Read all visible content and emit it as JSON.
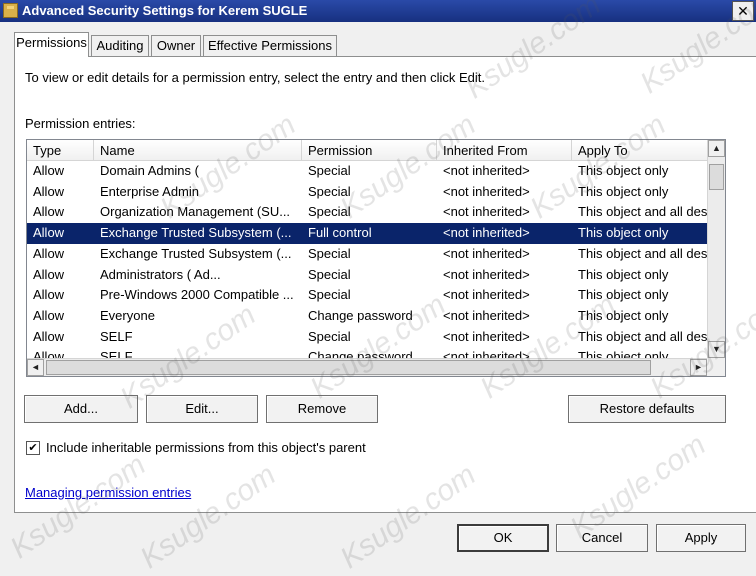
{
  "window": {
    "title": "Advanced Security Settings for Kerem SUGLE",
    "close_glyph": "✕"
  },
  "tabs": [
    {
      "label": "Permissions",
      "active": true
    },
    {
      "label": "Auditing",
      "active": false
    },
    {
      "label": "Owner",
      "active": false
    },
    {
      "label": "Effective Permissions",
      "active": false
    }
  ],
  "instruction": "To view or edit details for a permission entry, select the entry and then click Edit.",
  "entries_label": "Permission entries:",
  "columns": [
    "Type",
    "Name",
    "Permission",
    "Inherited From",
    "Apply To"
  ],
  "rows": [
    {
      "type": "Allow",
      "name": "Domain Admins (",
      "permission": "Special",
      "inherited": "<not inherited>",
      "apply": "This object only",
      "selected": false
    },
    {
      "type": "Allow",
      "name": "Enterprise Admin",
      "permission": "Special",
      "inherited": "<not inherited>",
      "apply": "This object only",
      "selected": false
    },
    {
      "type": "Allow",
      "name": "Organization Management (SU...",
      "permission": "Special",
      "inherited": "<not inherited>",
      "apply": "This object and all des",
      "selected": false
    },
    {
      "type": "Allow",
      "name": "Exchange Trusted Subsystem (...",
      "permission": "Full control",
      "inherited": "<not inherited>",
      "apply": "This object only",
      "selected": true
    },
    {
      "type": "Allow",
      "name": "Exchange Trusted Subsystem (...",
      "permission": "Special",
      "inherited": "<not inherited>",
      "apply": "This object and all des",
      "selected": false
    },
    {
      "type": "Allow",
      "name": "Administrators (                    Ad...",
      "permission": "Special",
      "inherited": "<not inherited>",
      "apply": "This object only",
      "selected": false
    },
    {
      "type": "Allow",
      "name": "Pre-Windows 2000 Compatible ...",
      "permission": "Special",
      "inherited": "<not inherited>",
      "apply": "This object only",
      "selected": false
    },
    {
      "type": "Allow",
      "name": "Everyone",
      "permission": "Change password",
      "inherited": "<not inherited>",
      "apply": "This object only",
      "selected": false
    },
    {
      "type": "Allow",
      "name": "SELF",
      "permission": "Special",
      "inherited": "<not inherited>",
      "apply": "This object and all des",
      "selected": false
    },
    {
      "type": "Allow",
      "name": "SELF",
      "permission": "Change password",
      "inherited": "<not inherited>",
      "apply": "This object only",
      "selected": false
    }
  ],
  "buttons": {
    "add": "Add...",
    "edit": "Edit...",
    "remove": "Remove",
    "restore": "Restore defaults",
    "ok": "OK",
    "cancel": "Cancel",
    "apply": "Apply"
  },
  "inherit_checkbox": {
    "label": "Include inheritable permissions from this object's parent",
    "checked": true,
    "glyph": "✔"
  },
  "link": "Managing permission entries",
  "scroll_glyphs": {
    "up": "▲",
    "down": "▼",
    "left": "◄",
    "right": "►"
  },
  "watermark": "Ksugle.com",
  "colors": {
    "title_bar": "#1f3a93",
    "selection": "#0a246a",
    "link": "#0000cc"
  }
}
